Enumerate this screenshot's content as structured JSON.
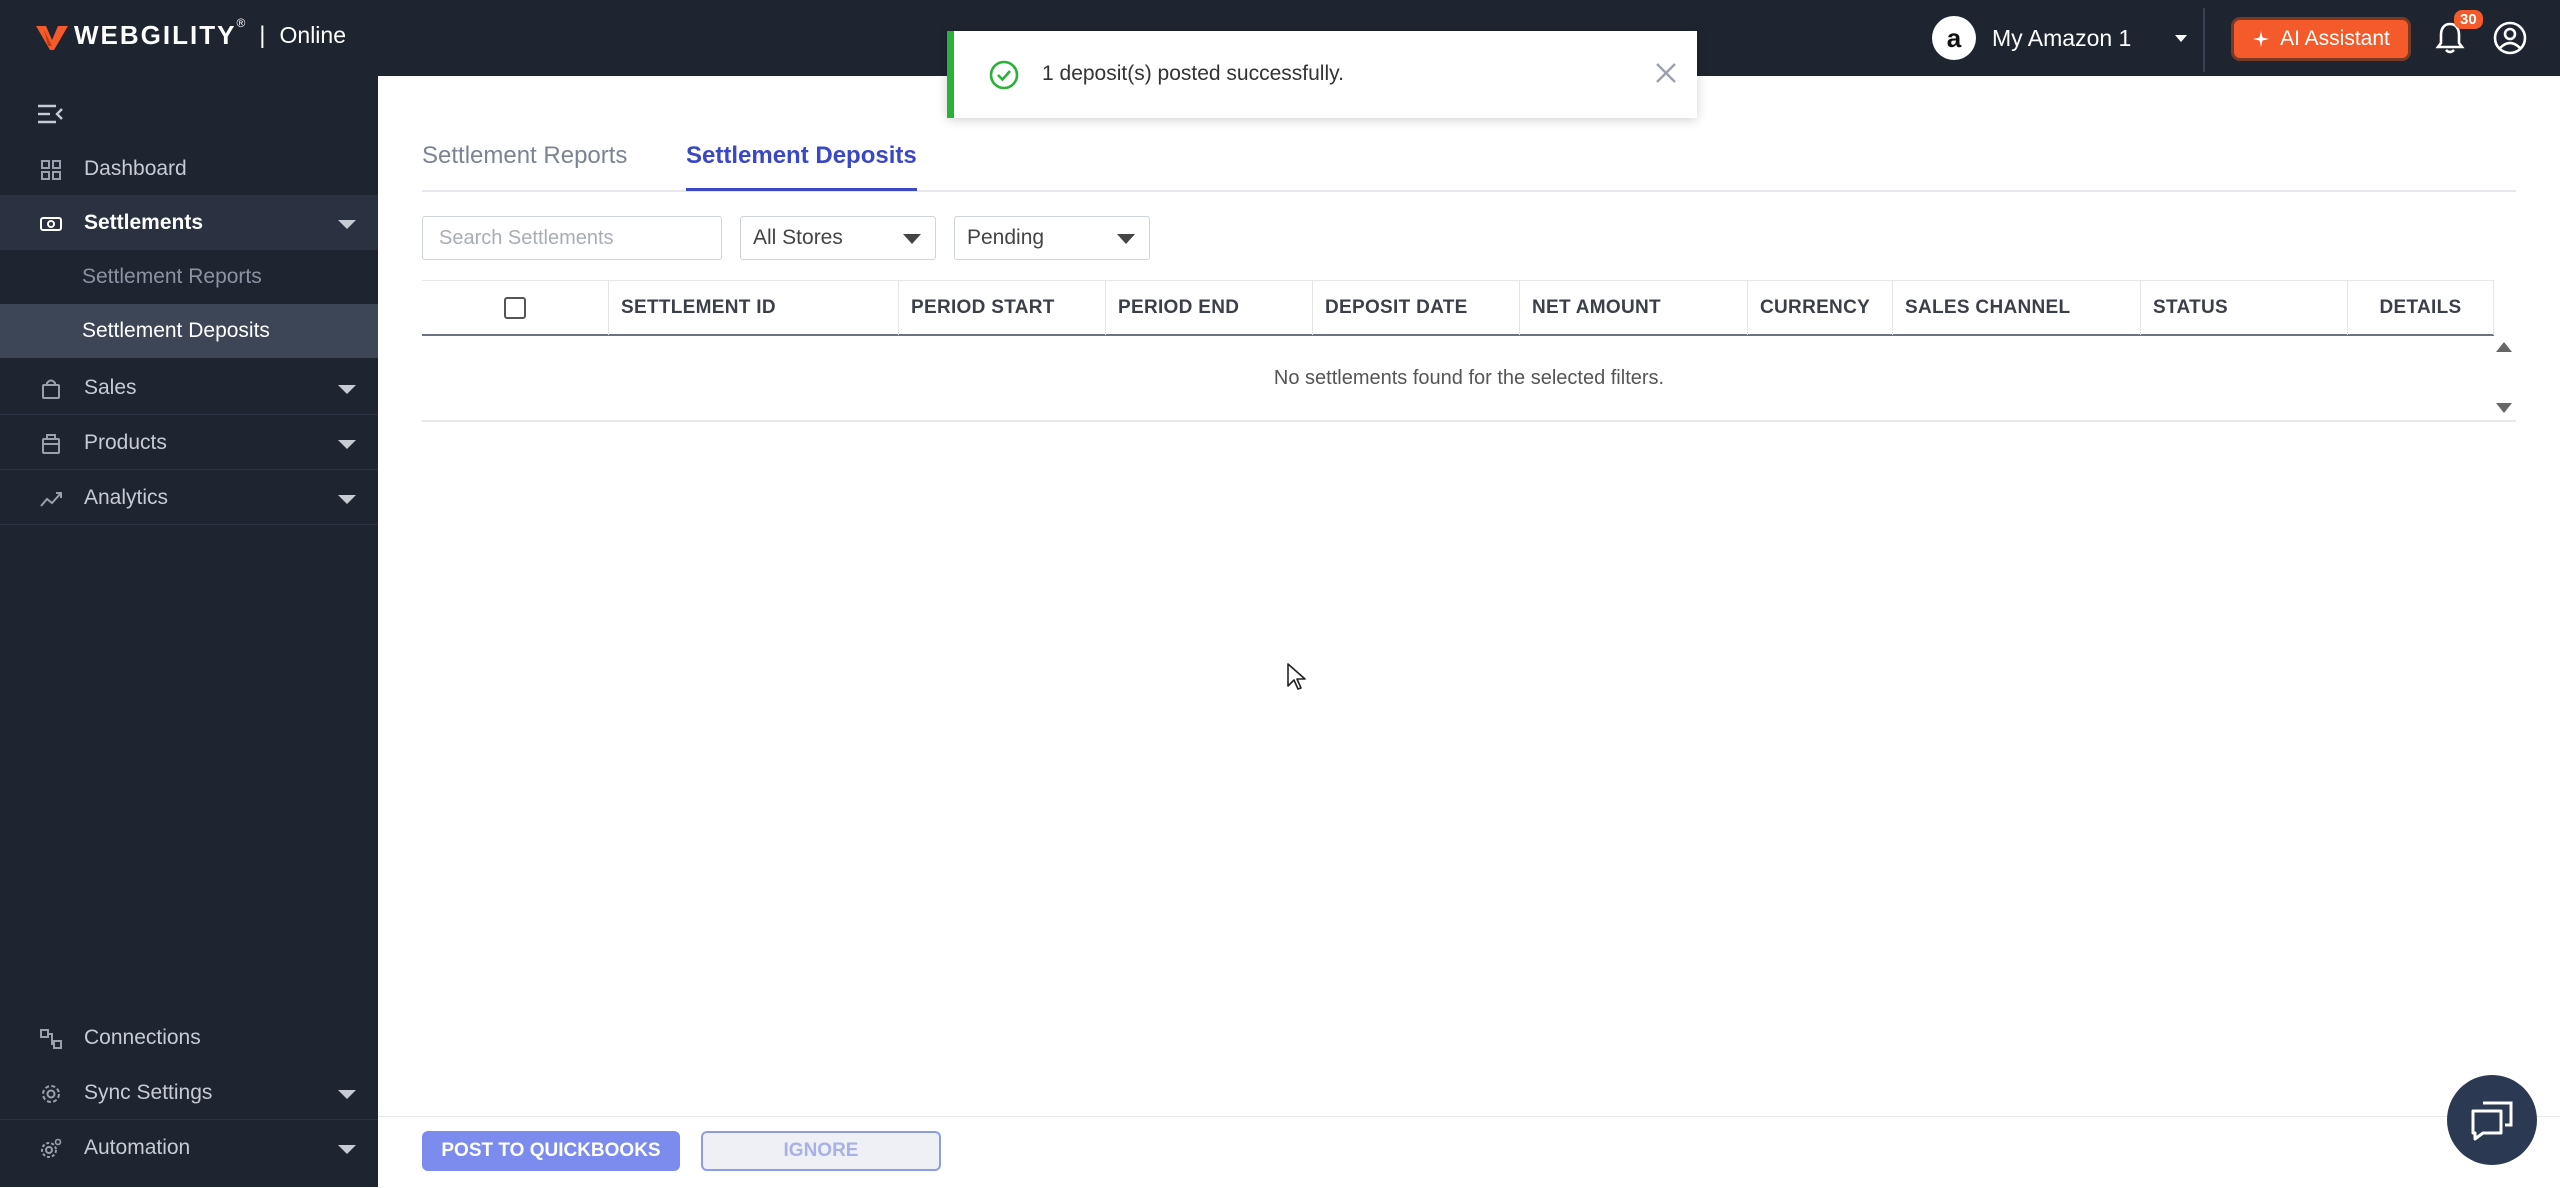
{
  "header": {
    "brand": "WEBGILITY",
    "brand_mark": "®",
    "separator": "|",
    "brand_sub": "Online",
    "store_avatar": "a",
    "store_name": "My Amazon 1",
    "ai_label": "AI Assistant",
    "notification_count": "30",
    "colors": {
      "bar": "#1e2430",
      "accent": "#f45a2a"
    }
  },
  "toast": {
    "message": "1 deposit(s) posted successfully.",
    "status_color": "#2ab13a"
  },
  "sidebar": {
    "items": [
      {
        "label": "Dashboard",
        "icon": "dashboard-icon"
      },
      {
        "label": "Settlements",
        "icon": "settlements-icon"
      },
      {
        "label": "Sales",
        "icon": "sales-bag-icon"
      },
      {
        "label": "Products",
        "icon": "products-icon"
      },
      {
        "label": "Analytics",
        "icon": "analytics-icon"
      },
      {
        "label": "Connections",
        "icon": "connections-icon"
      },
      {
        "label": "Sync Settings",
        "icon": "gear-icon"
      },
      {
        "label": "Automation",
        "icon": "automation-icon"
      }
    ],
    "sub_items": [
      {
        "label": "Settlement Reports"
      },
      {
        "label": "Settlement Deposits"
      }
    ]
  },
  "main": {
    "tabs": [
      {
        "label": "Settlement Reports"
      },
      {
        "label": "Settlement Deposits"
      }
    ],
    "search_placeholder": "Search Settlements",
    "store_filter": "All Stores",
    "status_filter": "Pending",
    "columns": [
      "SETTLEMENT ID",
      "PERIOD START",
      "PERIOD END",
      "DEPOSIT DATE",
      "NET AMOUNT",
      "CURRENCY",
      "SALES CHANNEL",
      "STATUS",
      "DETAILS"
    ],
    "empty_message": "No settlements found for the selected filters."
  },
  "footer": {
    "post_label": "POST TO QUICKBOOKS",
    "ignore_label": "IGNORE"
  }
}
